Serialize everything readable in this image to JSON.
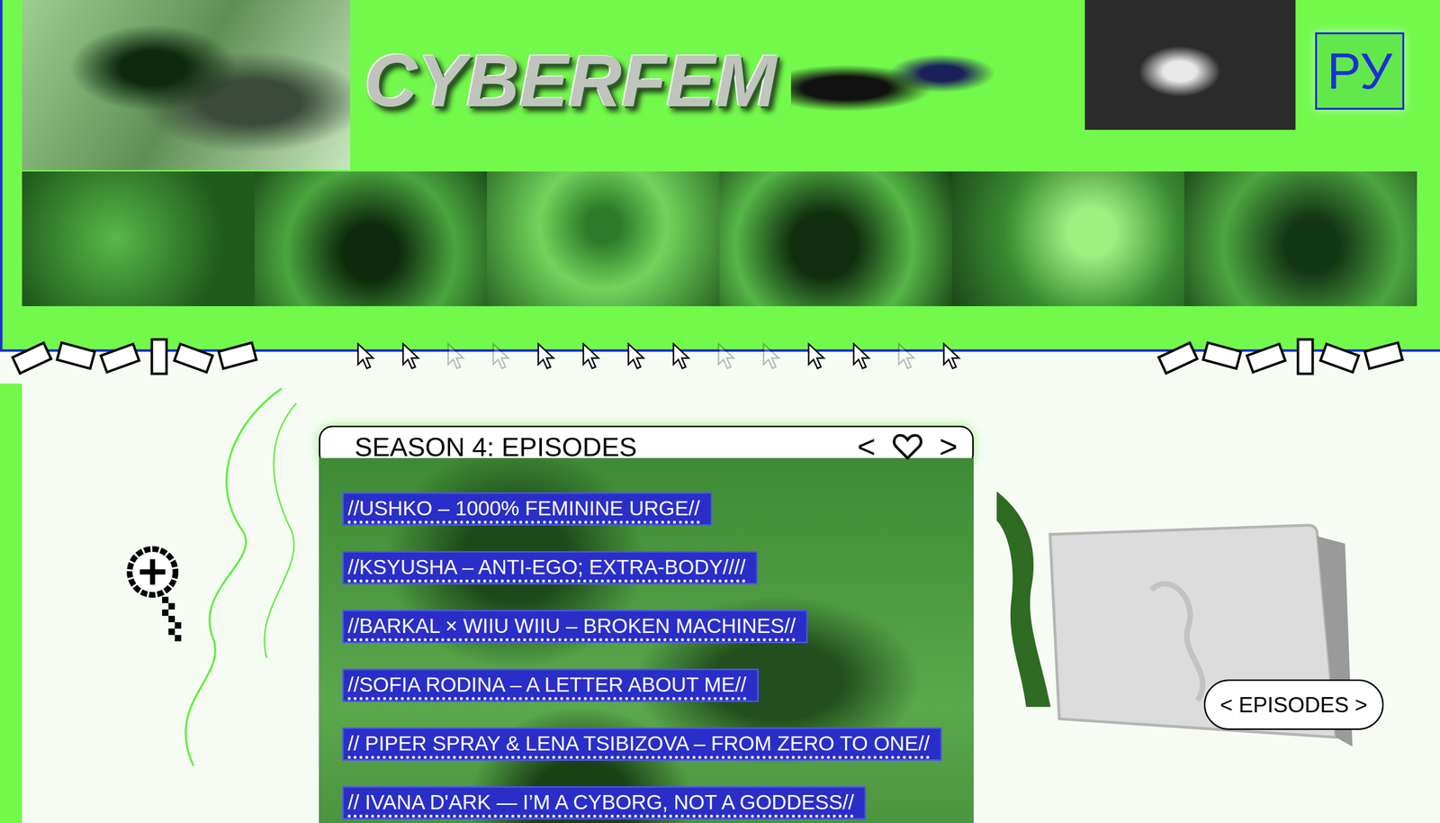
{
  "logo": "CYBERFEM",
  "language_button": "РУ",
  "episodes_panel": {
    "title": "SEASON 4: EPISODES",
    "prev": "<",
    "next": ">",
    "favorite": false
  },
  "episodes": [
    "//USHKO – 1000% FEMININE URGE//",
    "//KSYUSHA – ANTI-EGO; EXTRA-BODY////",
    "//BARKAL × WIIU WIIU – BROKEN MACHINES//",
    "//SOFIA RODINA – A LETTER ABOUT ME//",
    "// PIPER SPRAY & LENA TSIBIZOVA – FROM ZERO TO ONE//",
    "// IVANA D'ARK — I’M A CYBORG, NOT A GODDESS//"
  ],
  "episodes_button": "< EPISODES >"
}
